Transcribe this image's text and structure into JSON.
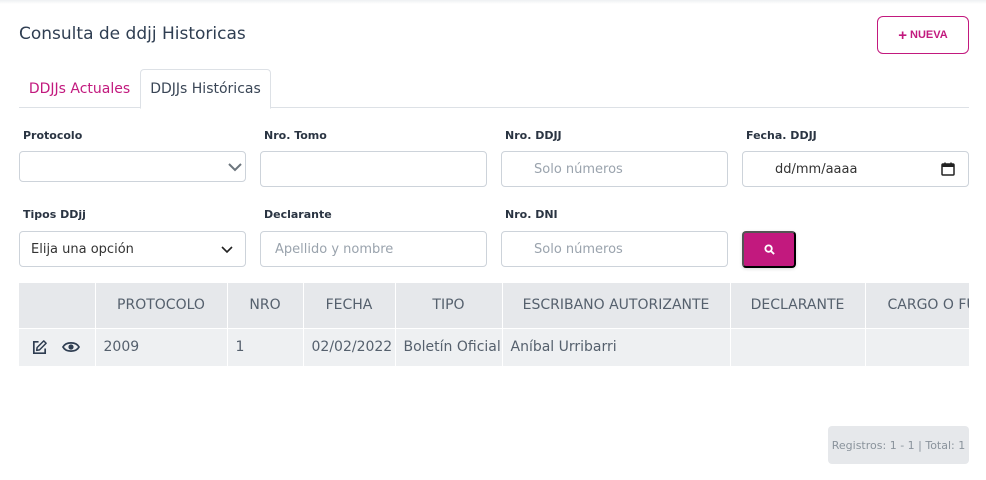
{
  "header": {
    "title": "Consulta de ddjj Historicas",
    "new_button_label": "NUEVA"
  },
  "tabs": [
    {
      "label": "DDJJs Actuales",
      "active": false
    },
    {
      "label": "DDJJs Históricas",
      "active": true
    }
  ],
  "filters": {
    "protocolo": {
      "label": "Protocolo",
      "value": ""
    },
    "nro_tomo": {
      "label": "Nro. Tomo",
      "value": ""
    },
    "nro_ddjj": {
      "label": "Nro. DDJJ",
      "placeholder": "Solo números"
    },
    "fecha_ddjj": {
      "label": "Fecha. DDJJ",
      "value": "dd/mm/aaaa"
    },
    "tipos_ddjj": {
      "label": "Tipos DDjj",
      "value": "Elija una opción"
    },
    "declarante": {
      "label": "Declarante",
      "placeholder": "Apellido y nombre"
    },
    "nro_dni": {
      "label": "Nro. DNI",
      "placeholder": "Solo números"
    }
  },
  "table": {
    "columns": [
      "",
      "PROTOCOLO",
      "NRO",
      "FECHA",
      "TIPO",
      "ESCRIBANO AUTORIZANTE",
      "DECLARANTE",
      "CARGO O FU"
    ],
    "rows": [
      {
        "protocolo": "2009",
        "nro": "1",
        "fecha": "02/02/2022",
        "tipo": "Boletín Oficial",
        "escribano": "Aníbal Urribarri",
        "declarante": "",
        "cargo": ""
      }
    ]
  },
  "pagination": {
    "info": "Registros: 1 - 1 | Total: 1"
  },
  "colors": {
    "accent": "#c2197e",
    "header_bg": "#e6e8eb",
    "row_bg": "#eef0f2"
  },
  "icons": [
    "plus-icon",
    "chevron-down-icon",
    "calendar-icon",
    "search-icon",
    "edit-icon",
    "eye-icon"
  ]
}
